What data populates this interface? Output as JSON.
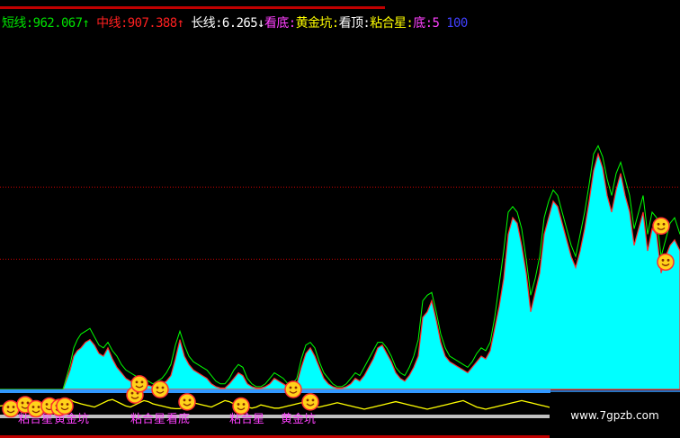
{
  "legend": {
    "short_label": "短线:",
    "short_value": "962.067",
    "short_arrow": "↑",
    "mid_label": "中线:",
    "mid_value": "907.388",
    "mid_arrow": "↑",
    "long_label": "长线:",
    "long_value": "6.265",
    "long_arrow": "↓",
    "signal_bottom": "看底:",
    "signal_golden": "黄金坑:",
    "signal_top": "看顶:",
    "signal_bond": "粘合星:",
    "signal_base_label": "底:",
    "signal_base_value": "5",
    "signal_extra_value": "100"
  },
  "colors": {
    "short": "#00e000",
    "mid": "#ff2020",
    "long": "#ffffff",
    "magenta": "#ff40ff",
    "yellow": "#ffff00",
    "white": "#ffffff",
    "blue": "#4040ff",
    "fill": "#00ffff",
    "outline": "#00ff00",
    "peak": "#ff3030",
    "gridline": "#c00000",
    "baseline": "#3399ff",
    "oscillator": "#ffff00",
    "gray_line": "#c0c0c0"
  },
  "chart_data": {
    "type": "area",
    "ylim": [
      0,
      1000
    ],
    "gridlines": [
      470,
      730
    ],
    "x": [
      0,
      10,
      20,
      30,
      40,
      50,
      60,
      70,
      78,
      82,
      86,
      90,
      95,
      100,
      105,
      110,
      115,
      120,
      125,
      130,
      135,
      140,
      145,
      150,
      155,
      160,
      165,
      170,
      175,
      180,
      185,
      190,
      195,
      200,
      205,
      210,
      215,
      220,
      225,
      230,
      235,
      240,
      245,
      250,
      255,
      260,
      265,
      270,
      275,
      280,
      285,
      290,
      295,
      300,
      305,
      310,
      315,
      320,
      325,
      330,
      335,
      340,
      345,
      350,
      355,
      360,
      365,
      370,
      375,
      380,
      385,
      390,
      395,
      400,
      405,
      410,
      415,
      420,
      425,
      430,
      435,
      440,
      445,
      450,
      455,
      460,
      465,
      470,
      475,
      480,
      485,
      490,
      495,
      500,
      505,
      510,
      515,
      520,
      525,
      530,
      535,
      540,
      545,
      550,
      555,
      560,
      565,
      570,
      575,
      580,
      585,
      590,
      595,
      600,
      605,
      610,
      615,
      620,
      625,
      630,
      635,
      640,
      645,
      650,
      655,
      660,
      665,
      670,
      675,
      680,
      685,
      690,
      695,
      700,
      705,
      710,
      715,
      720,
      725,
      730,
      735,
      740,
      745,
      750,
      756
    ],
    "fill": [
      0,
      0,
      0,
      0,
      0,
      0,
      0,
      0,
      70,
      120,
      140,
      150,
      170,
      180,
      160,
      130,
      120,
      150,
      110,
      80,
      60,
      40,
      30,
      25,
      20,
      20,
      15,
      10,
      15,
      20,
      30,
      50,
      110,
      180,
      120,
      90,
      70,
      60,
      50,
      40,
      20,
      10,
      5,
      5,
      20,
      40,
      60,
      50,
      20,
      10,
      5,
      5,
      10,
      20,
      40,
      30,
      20,
      10,
      10,
      20,
      80,
      130,
      150,
      120,
      80,
      40,
      20,
      10,
      5,
      5,
      10,
      20,
      40,
      30,
      50,
      80,
      110,
      150,
      160,
      130,
      100,
      60,
      40,
      30,
      50,
      80,
      120,
      260,
      280,
      320,
      250,
      170,
      120,
      100,
      90,
      80,
      70,
      60,
      80,
      100,
      120,
      110,
      140,
      220,
      300,
      400,
      560,
      620,
      600,
      520,
      420,
      280,
      350,
      420,
      560,
      620,
      680,
      660,
      600,
      540,
      480,
      440,
      500,
      580,
      680,
      790,
      850,
      800,
      700,
      640,
      720,
      780,
      700,
      640,
      520,
      580,
      640,
      500,
      580,
      560,
      420,
      480,
      520,
      540,
      500,
      460
    ],
    "outline": [
      0,
      0,
      0,
      0,
      0,
      0,
      0,
      0,
      90,
      150,
      180,
      200,
      210,
      220,
      190,
      160,
      150,
      170,
      140,
      120,
      90,
      70,
      60,
      50,
      40,
      40,
      30,
      20,
      30,
      40,
      60,
      90,
      160,
      210,
      160,
      120,
      100,
      90,
      80,
      70,
      50,
      30,
      20,
      20,
      40,
      70,
      90,
      80,
      40,
      20,
      10,
      10,
      20,
      40,
      60,
      50,
      40,
      20,
      20,
      40,
      110,
      160,
      170,
      150,
      100,
      60,
      40,
      20,
      10,
      10,
      20,
      40,
      60,
      50,
      80,
      110,
      140,
      170,
      170,
      150,
      120,
      80,
      60,
      50,
      80,
      120,
      180,
      320,
      340,
      350,
      280,
      200,
      150,
      120,
      110,
      100,
      90,
      80,
      100,
      130,
      150,
      140,
      170,
      260,
      380,
      500,
      640,
      660,
      640,
      580,
      470,
      340,
      400,
      480,
      620,
      680,
      720,
      700,
      640,
      580,
      520,
      480,
      560,
      640,
      740,
      850,
      880,
      840,
      760,
      700,
      780,
      820,
      760,
      700,
      580,
      640,
      700,
      560,
      640,
      620,
      480,
      540,
      600,
      620,
      560,
      500
    ],
    "oscillator": [
      30,
      40,
      60,
      30,
      10,
      20,
      40,
      80,
      90,
      70,
      60,
      50,
      40,
      30,
      20,
      40,
      60,
      80,
      90,
      70,
      50,
      30,
      20,
      40,
      60,
      80,
      70,
      50,
      40,
      30,
      20,
      10,
      5,
      5,
      20,
      40,
      60,
      50,
      40,
      30,
      20,
      40,
      60,
      80,
      70,
      50,
      40,
      30,
      20,
      10,
      20,
      40,
      30,
      20,
      10,
      10,
      20,
      30,
      40,
      50,
      60,
      40,
      30,
      20,
      20,
      30,
      40,
      50,
      60,
      50,
      40,
      30,
      20,
      10,
      0,
      10,
      20,
      30,
      40,
      50,
      60,
      70,
      60,
      50,
      40,
      30,
      20,
      10,
      0,
      10,
      20,
      30,
      40,
      50,
      60,
      70,
      80,
      60,
      40,
      20,
      10,
      0,
      10,
      20,
      30,
      40,
      50,
      60,
      70,
      80,
      70,
      60,
      50,
      40,
      30,
      20,
      10,
      0,
      10,
      20,
      30,
      40,
      50,
      60,
      70,
      80,
      70,
      60,
      50,
      40,
      30,
      20,
      10,
      0,
      10,
      20,
      30,
      40,
      50,
      60,
      70,
      80,
      70,
      60,
      50,
      40
    ],
    "smiley_markers": [
      {
        "x": 12,
        "y": -70
      },
      {
        "x": 28,
        "y": -55
      },
      {
        "x": 40,
        "y": -70
      },
      {
        "x": 55,
        "y": -60
      },
      {
        "x": 66,
        "y": -65
      },
      {
        "x": 72,
        "y": -60
      },
      {
        "x": 150,
        "y": -20
      },
      {
        "x": 155,
        "y": 20
      },
      {
        "x": 178,
        "y": 0
      },
      {
        "x": 208,
        "y": -45
      },
      {
        "x": 268,
        "y": -60
      },
      {
        "x": 326,
        "y": 0
      },
      {
        "x": 345,
        "y": -45
      },
      {
        "x": 735,
        "y": 590
      },
      {
        "x": 740,
        "y": 460
      }
    ],
    "signal_labels": [
      {
        "x": 20,
        "text": "粘合星"
      },
      {
        "x": 60,
        "text": "黄金坑"
      },
      {
        "x": 145,
        "text": "粘合星"
      },
      {
        "x": 185,
        "text": "看底"
      },
      {
        "x": 255,
        "text": "粘合星"
      },
      {
        "x": 312,
        "text": "黄金坑"
      }
    ]
  },
  "watermark": "www.7gpzb.com"
}
